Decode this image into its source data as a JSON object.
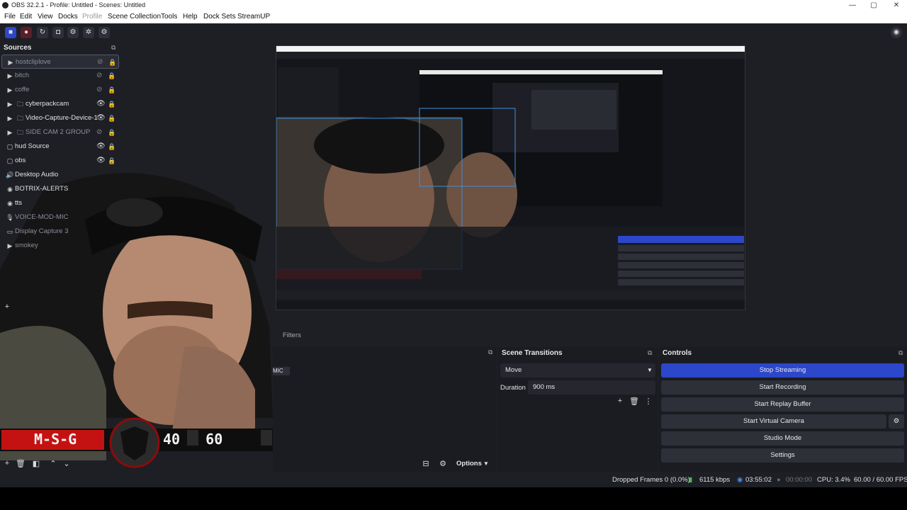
{
  "window": {
    "title": "OBS 32.2.1 - Profile: Untitled - Scenes: Untitled",
    "controls": [
      "—",
      "▢",
      "✕"
    ]
  },
  "menu": [
    "File",
    "Edit",
    "View",
    "Docks",
    "Profile",
    "Scene Collection",
    "Tools",
    "Help",
    "Dock Sets",
    "StreamUP"
  ],
  "sources": {
    "title": "Sources",
    "items": [
      {
        "name": "hostcliplove",
        "kind": "play",
        "visible": false,
        "selected": true
      },
      {
        "name": "bitch",
        "kind": "play",
        "visible": false
      },
      {
        "name": "coffe",
        "kind": "play",
        "visible": false
      },
      {
        "name": "cyberpackcam",
        "kind": "group",
        "visible": true
      },
      {
        "name": "Video-Capture-Device-1",
        "kind": "group",
        "visible": true
      },
      {
        "name": "SIDE CAM 2 GROUP",
        "kind": "group",
        "visible": false
      },
      {
        "name": "hud Source",
        "kind": "window",
        "visible": true
      },
      {
        "name": "obs",
        "kind": "window",
        "visible": true
      },
      {
        "name": "Desktop Audio",
        "kind": "audio",
        "visible": true
      },
      {
        "name": "BOTRIX-ALERTS",
        "kind": "browser",
        "visible": true
      },
      {
        "name": "tts",
        "kind": "browser",
        "visible": true
      },
      {
        "name": "VOICE-MOD-MIC",
        "kind": "mic",
        "visible": false
      },
      {
        "name": "Display Capture 3",
        "kind": "display",
        "visible": false
      },
      {
        "name": "smokey",
        "kind": "play",
        "visible": false
      }
    ]
  },
  "overlay": {
    "left_text": "M-S-G",
    "right_text": "40 ⁄ 60"
  },
  "filters_tab": "Filters",
  "audio_mixer": {
    "partial_label": "MIC"
  },
  "scene_transitions": {
    "title": "Scene Transitions",
    "transition": "Move",
    "duration_label": "Duration",
    "duration_value": "900 ms"
  },
  "controls": {
    "title": "Controls",
    "buttons": [
      "Stop Streaming",
      "Start Recording",
      "Start Replay Buffer",
      "Start Virtual Camera",
      "Studio Mode",
      "Settings"
    ]
  },
  "mixer_footer": {
    "options_label": "Options"
  },
  "status": {
    "dropped_frames": "Dropped Frames 0 (0.0%)",
    "bitrate": "6115 kbps",
    "stream_time": "03:55:02",
    "record_time": "00:00:00",
    "cpu": "CPU: 3.4%",
    "fps": "60.00 / 60.00 FPS"
  },
  "colors": {
    "accent": "#2c47c9",
    "panel": "#1e1f25",
    "overlay_red": "#c41212"
  }
}
